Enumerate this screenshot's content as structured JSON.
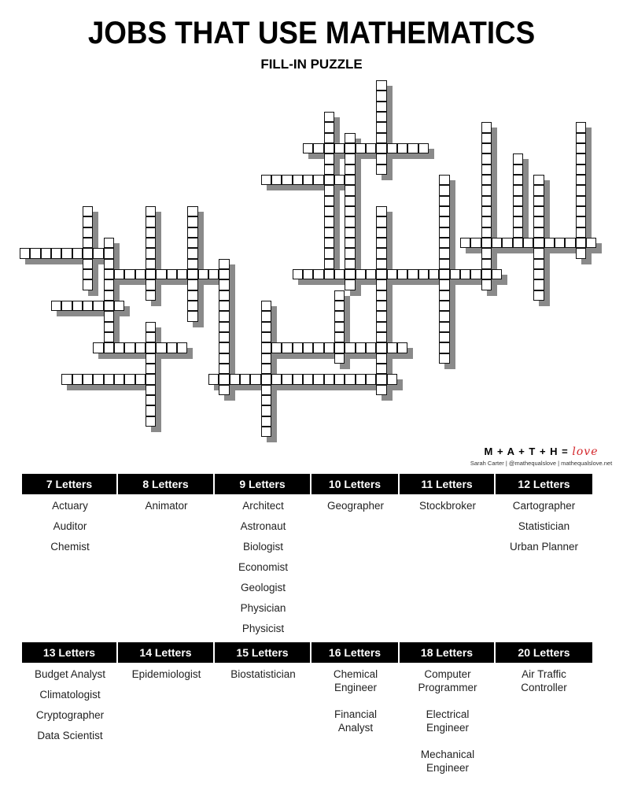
{
  "title": "JOBS THAT USE MATHEMATICS",
  "subtitle": "FILL-IN PUZZLE",
  "brand": {
    "logo_text": "M + A + T + H =",
    "logo_love": "love",
    "credit": "Sarah Carter | @mathequalslove | mathequalslove.net",
    "accent_color": "#d4262b"
  },
  "puzzle": {
    "across": [
      {
        "row": 6,
        "col": 27,
        "length": 12
      },
      {
        "row": 9,
        "col": 23,
        "length": 9
      },
      {
        "row": 15,
        "col": 42,
        "length": 13
      },
      {
        "row": 16,
        "col": 0,
        "length": 9
      },
      {
        "row": 18,
        "col": 8,
        "length": 12
      },
      {
        "row": 18,
        "col": 26,
        "length": 20
      },
      {
        "row": 21,
        "col": 3,
        "length": 7
      },
      {
        "row": 25,
        "col": 7,
        "length": 9
      },
      {
        "row": 25,
        "col": 23,
        "length": 14
      },
      {
        "row": 28,
        "col": 4,
        "length": 9
      },
      {
        "row": 28,
        "col": 18,
        "length": 18
      }
    ],
    "down": [
      {
        "row": 12,
        "col": 6,
        "length": 8
      },
      {
        "row": 15,
        "col": 8,
        "length": 10
      },
      {
        "row": 12,
        "col": 12,
        "length": 9
      },
      {
        "row": 23,
        "col": 12,
        "length": 10
      },
      {
        "row": 12,
        "col": 16,
        "length": 11
      },
      {
        "row": 17,
        "col": 19,
        "length": 13
      },
      {
        "row": 21,
        "col": 23,
        "length": 13
      },
      {
        "row": 3,
        "col": 29,
        "length": 16
      },
      {
        "row": 5,
        "col": 31,
        "length": 15
      },
      {
        "row": 20,
        "col": 30,
        "length": 7
      },
      {
        "row": 0,
        "col": 34,
        "length": 9
      },
      {
        "row": 12,
        "col": 34,
        "length": 18
      },
      {
        "row": 9,
        "col": 40,
        "length": 18
      },
      {
        "row": 4,
        "col": 44,
        "length": 16
      },
      {
        "row": 7,
        "col": 47,
        "length": 9
      },
      {
        "row": 9,
        "col": 49,
        "length": 12
      },
      {
        "row": 4,
        "col": 53,
        "length": 13
      }
    ]
  },
  "word_bank_top": [
    {
      "header": "7 Letters",
      "words": [
        "Actuary",
        "Auditor",
        "Chemist"
      ]
    },
    {
      "header": "8 Letters",
      "words": [
        "Animator"
      ]
    },
    {
      "header": "9 Letters",
      "words": [
        "Architect",
        "Astronaut",
        "Biologist",
        "Economist",
        "Geologist",
        "Physician",
        "Physicist"
      ]
    },
    {
      "header": "10 Letters",
      "words": [
        "Geographer"
      ]
    },
    {
      "header": "11 Letters",
      "words": [
        "Stockbroker"
      ]
    },
    {
      "header": "12 Letters",
      "words": [
        "Cartographer",
        "Statistician",
        "Urban Planner"
      ]
    }
  ],
  "word_bank_bottom": [
    {
      "header": "13 Letters",
      "words": [
        "Budget Analyst",
        "Climatologist",
        "Cryptographer",
        "Data Scientist"
      ]
    },
    {
      "header": "14 Letters",
      "words": [
        "Epidemiologist"
      ]
    },
    {
      "header": "15 Letters",
      "words": [
        "Biostatistician"
      ]
    },
    {
      "header": "16 Letters",
      "words": [
        "Chemical\nEngineer",
        "Financial\nAnalyst"
      ]
    },
    {
      "header": "18 Letters",
      "words": [
        "Computer\nProgrammer",
        "Electrical\nEngineer",
        "Mechanical\nEngineer"
      ]
    },
    {
      "header": "20 Letters",
      "words": [
        "Air Traffic\nController"
      ]
    }
  ]
}
